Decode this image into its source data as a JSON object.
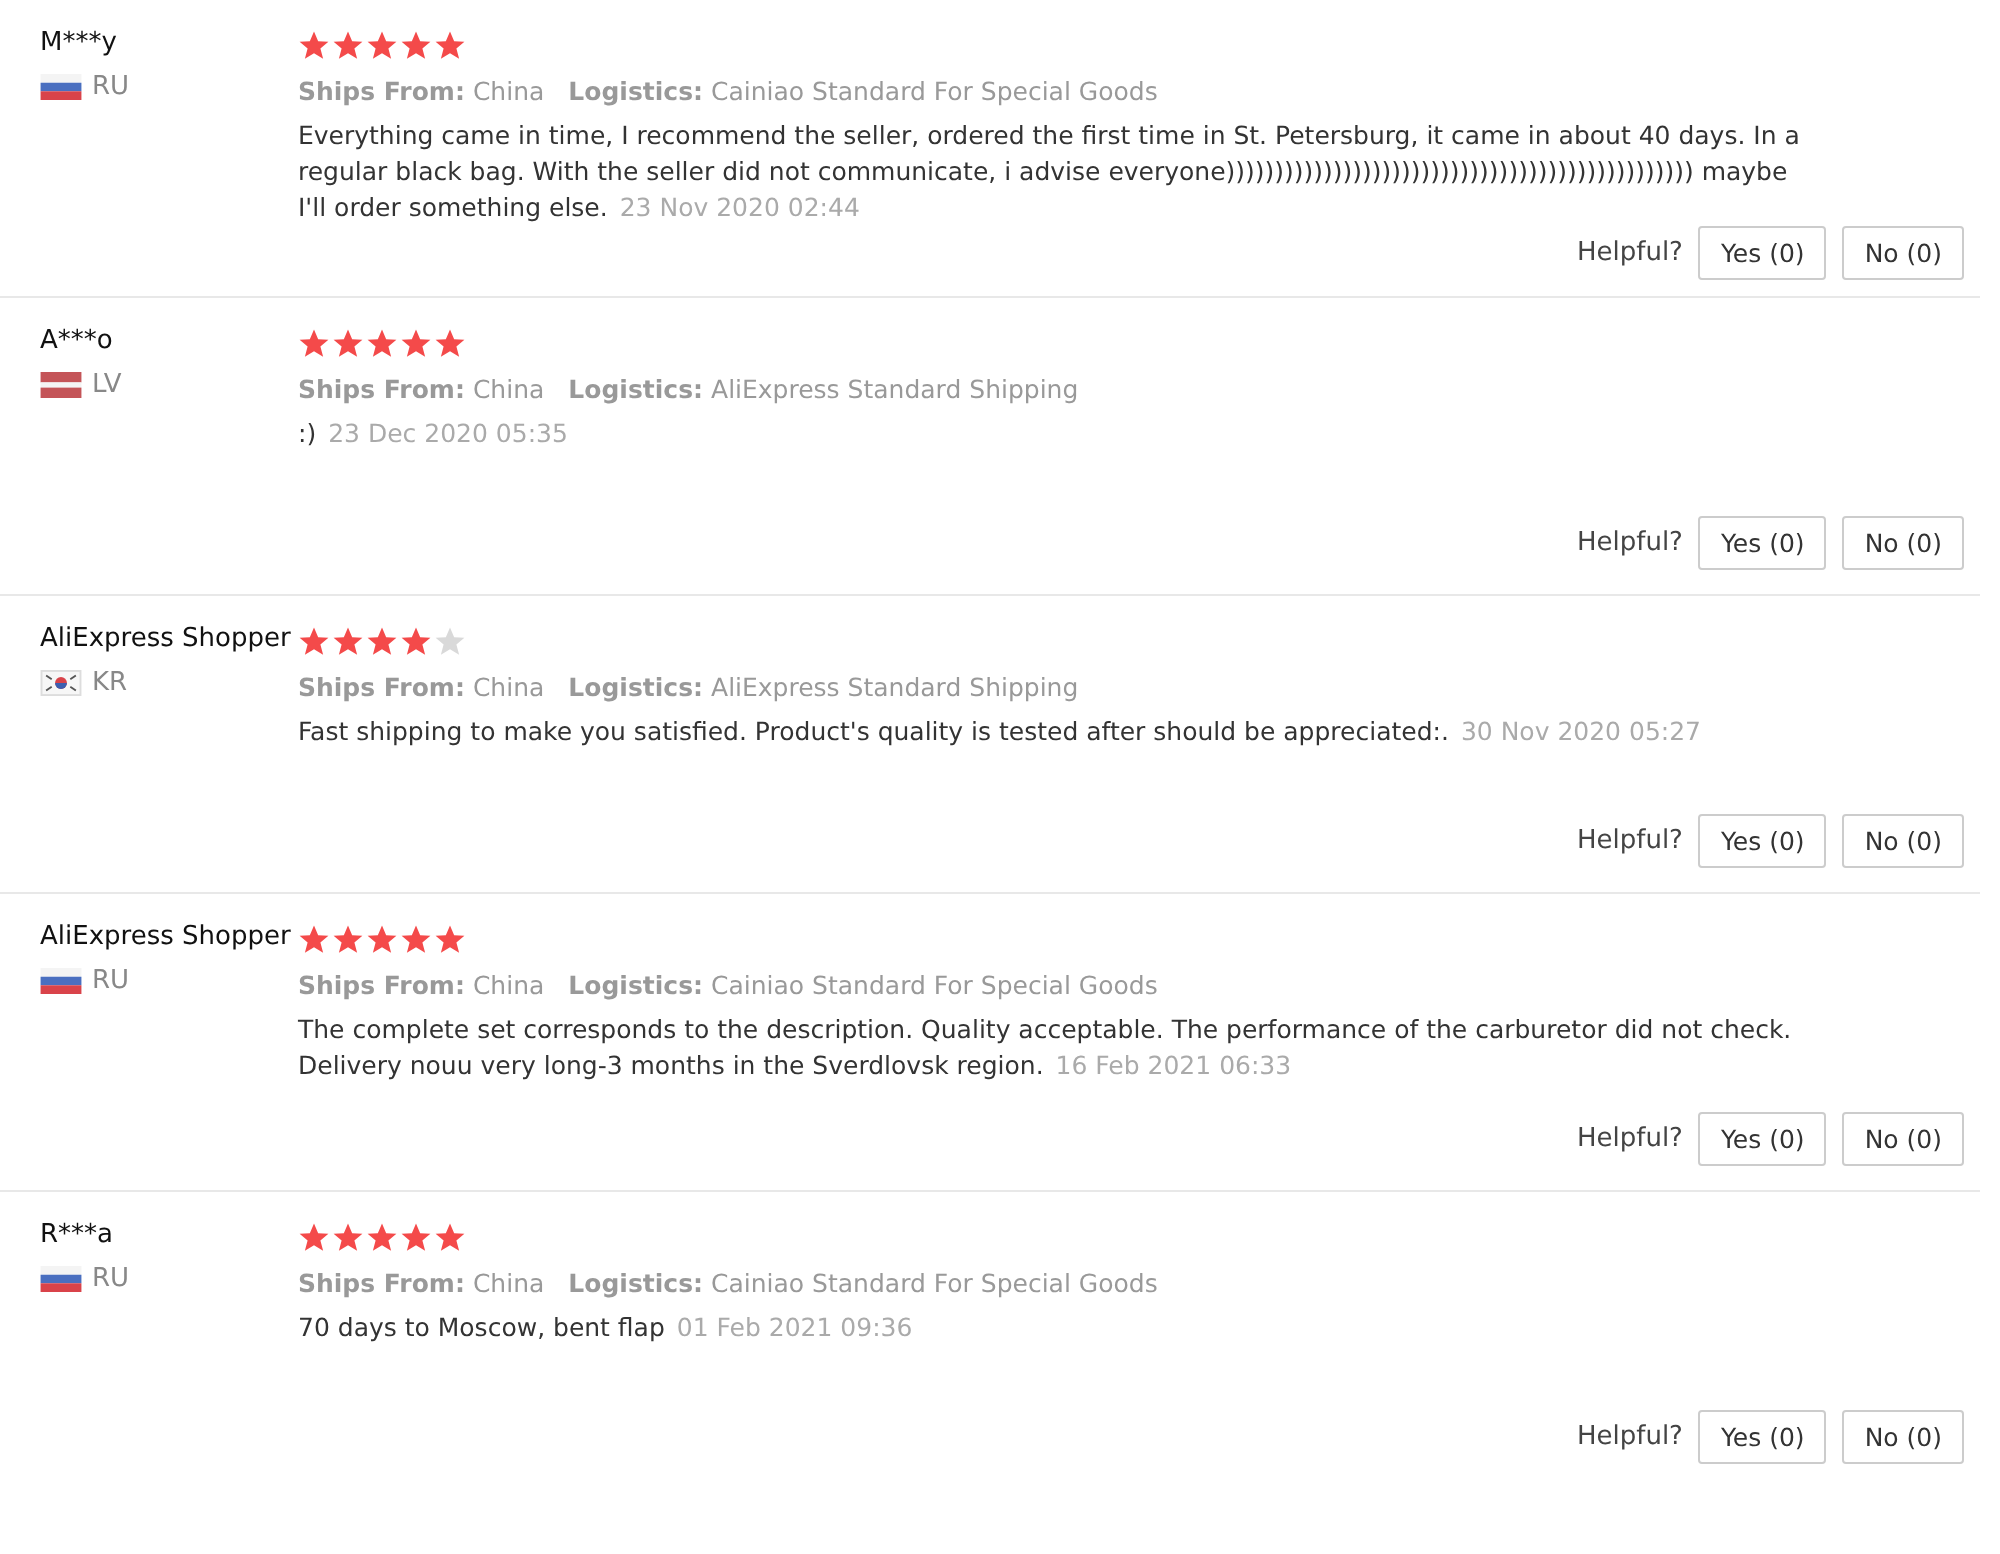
{
  "reviews": [
    {
      "user": "M***y",
      "flag": {
        "kind": "ru"
      },
      "country": "RU",
      "stars": 5,
      "ships_from_label": "Ships From:",
      "ships_from": "China",
      "logistics_label": "Logistics:",
      "logistics": "Cainiao Standard For Special Goods",
      "text": "Everything came in time, I recommend the seller, ordered the first time in St. Petersburg, it came in about 40 days. In a regular black bag. With the seller did not communicate, i advise everyone)))))))))))))))))))))))))))))))))))))))))))))))) maybe I'll order something else.",
      "date": "23 Nov 2020 02:44",
      "helpful_label": "Helpful?",
      "yes": "Yes (0)",
      "no": "No (0)"
    },
    {
      "user": "A***o",
      "flag": {
        "kind": "lv"
      },
      "country": "LV",
      "stars": 5,
      "ships_from_label": "Ships From:",
      "ships_from": "China",
      "logistics_label": "Logistics:",
      "logistics": "AliExpress Standard Shipping",
      "text": ":)",
      "date": "23 Dec 2020 05:35",
      "helpful_label": "Helpful?",
      "yes": "Yes (0)",
      "no": "No (0)"
    },
    {
      "user": "AliExpress Shopper",
      "flag": {
        "kind": "kr"
      },
      "country": "KR",
      "stars": 4,
      "ships_from_label": "Ships From:",
      "ships_from": "China",
      "logistics_label": "Logistics:",
      "logistics": "AliExpress Standard Shipping",
      "text": "Fast shipping to make you satisfied. Product's quality is tested after should be appreciated:.",
      "date": "30 Nov 2020 05:27",
      "helpful_label": "Helpful?",
      "yes": "Yes (0)",
      "no": "No (0)"
    },
    {
      "user": "AliExpress Shopper",
      "flag": {
        "kind": "ru"
      },
      "country": "RU",
      "stars": 5,
      "ships_from_label": "Ships From:",
      "ships_from": "China",
      "logistics_label": "Logistics:",
      "logistics": "Cainiao Standard For Special Goods",
      "text": "The complete set corresponds to the description. Quality acceptable. The performance of the carburetor did not check. Delivery nouu very long-3 months in the Sverdlovsk region.",
      "date": "16 Feb 2021 06:33",
      "helpful_label": "Helpful?",
      "yes": "Yes (0)",
      "no": "No (0)"
    },
    {
      "user": "R***a",
      "flag": {
        "kind": "ru"
      },
      "country": "RU",
      "stars": 5,
      "ships_from_label": "Ships From:",
      "ships_from": "China",
      "logistics_label": "Logistics:",
      "logistics": "Cainiao Standard For Special Goods",
      "text": "70 days to Moscow, bent flap",
      "date": "01 Feb 2021 09:36",
      "helpful_label": "Helpful?",
      "yes": "Yes (0)",
      "no": "No (0)"
    }
  ]
}
